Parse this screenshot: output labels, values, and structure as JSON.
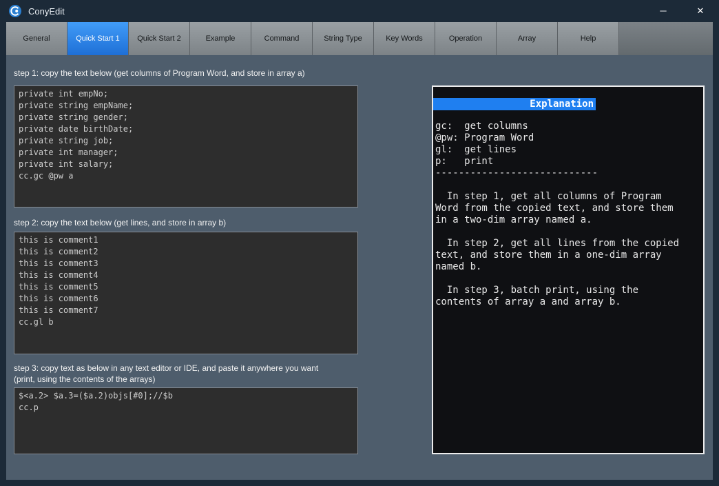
{
  "window": {
    "title": "ConyEdit",
    "minimize_icon": "─",
    "close_icon": "✕"
  },
  "tabs": [
    {
      "label": "General"
    },
    {
      "label": "Quick Start 1"
    },
    {
      "label": "Quick Start 2"
    },
    {
      "label": "Example"
    },
    {
      "label": "Command"
    },
    {
      "label": "String Type"
    },
    {
      "label": "Key Words"
    },
    {
      "label": "Operation"
    },
    {
      "label": "Array"
    },
    {
      "label": "Help"
    }
  ],
  "steps": [
    {
      "label": "step 1:  copy the text below (get columns of Program Word, and store in array a)",
      "code": "private int empNo;\nprivate string empName;\nprivate string gender;\nprivate date birthDate;\nprivate string job;\nprivate int manager;\nprivate int salary;\ncc.gc @pw a"
    },
    {
      "label": "step 2: copy the text below (get lines, and store in array b)",
      "code": "this is comment1\nthis is comment2\nthis is comment3\nthis is comment4\nthis is comment5\nthis is comment6\nthis is comment7\ncc.gl b"
    },
    {
      "label": "step 3: copy text as below in any text editor or IDE, and paste it anywhere you want\n(print, using the contents of the arrays)",
      "code": "$<a.2> $a.3=($a.2)objs[#0];//$b\ncc.p"
    }
  ],
  "explanation": {
    "title": "Explanation",
    "body": "gc:  get columns\n@pw: Program Word\ngl:  get lines\np:   print\n----------------------------\n\n  In step 1, get all columns of Program\nWord from the copied text, and store them\nin a two-dim array named a.\n\n  In step 2, get all lines from the copied\ntext, and store them in a one-dim array\nnamed b.\n\n  In step 3, batch print, using the\ncontents of array a and array b."
  },
  "colors": {
    "titlebar_bg": "#1c2a38",
    "content_bg": "#4e5d6c",
    "active_tab_blue": "#2b8ff5",
    "code_block_bg": "#2d2d2d",
    "panel_bg": "#0f1013",
    "highlight_blue": "#1f7ff0"
  }
}
